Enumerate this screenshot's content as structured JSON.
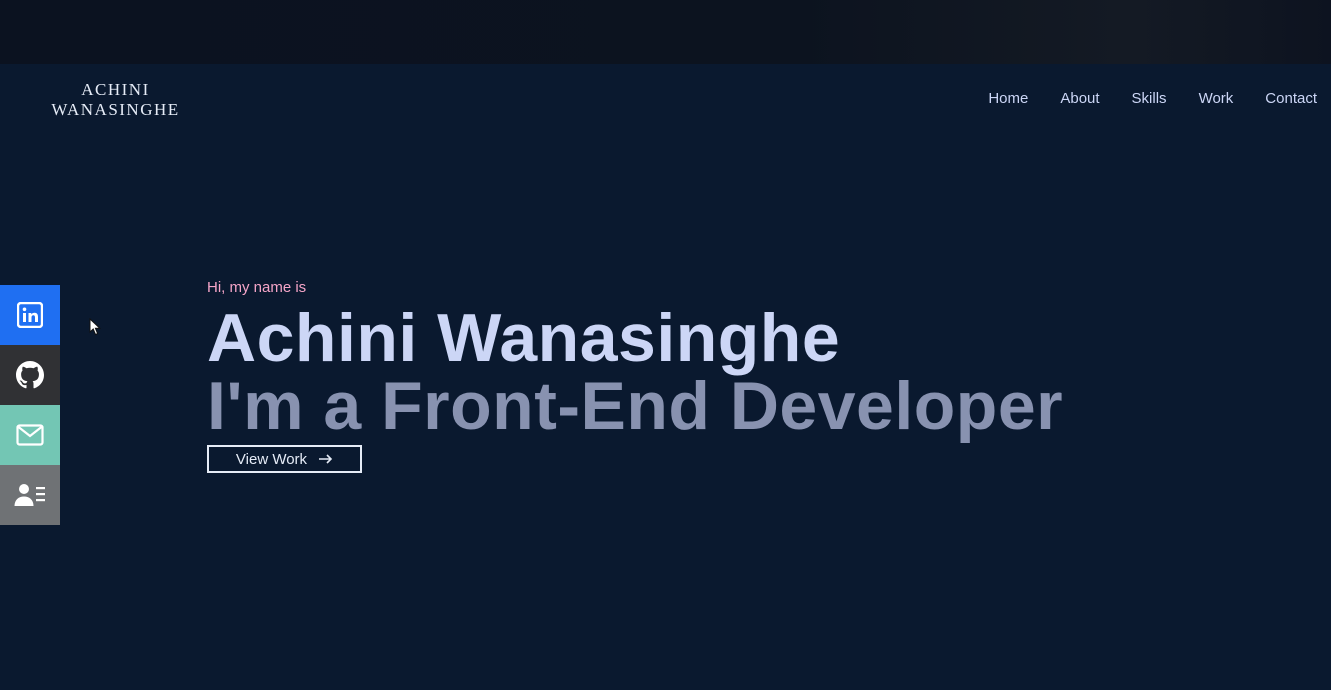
{
  "logo": {
    "line1": "ACHINI",
    "line2": "WANASINGHE"
  },
  "nav": {
    "items": [
      "Home",
      "About",
      "Skills",
      "Work",
      "Contact"
    ]
  },
  "social": {
    "icons": [
      "linkedin-icon",
      "github-icon",
      "mail-icon",
      "resume-icon"
    ],
    "colors": {
      "linkedin": "#1f6ff2",
      "github": "#303134",
      "mail": "#73c6b4",
      "resume": "#6f7275"
    }
  },
  "hero": {
    "greeting": "Hi, my name is",
    "name": "Achini Wanasinghe",
    "role": "I'm a Front-End Developer",
    "button_label": "View Work",
    "button_icon": "arrow-right-icon"
  },
  "colors": {
    "background": "#0a192f",
    "greeting": "#f5a5c8",
    "name": "#ccd6f6",
    "role": "#8892b0"
  }
}
